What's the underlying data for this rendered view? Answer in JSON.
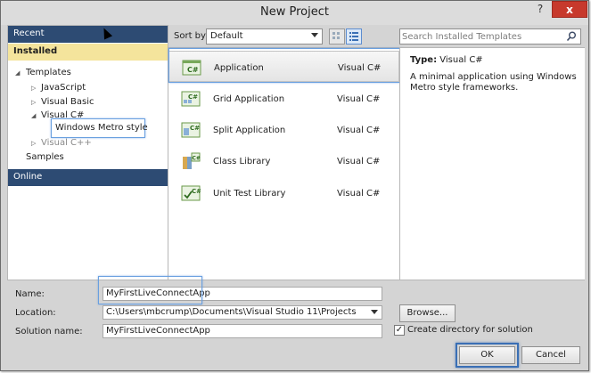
{
  "window": {
    "title": "New Project",
    "help_label": "?",
    "close_label": "x"
  },
  "left_pane": {
    "recent_label": "Recent",
    "installed_label": "Installed",
    "online_label": "Online",
    "tree": {
      "templates": "Templates",
      "javascript": "JavaScript",
      "visual_basic": "Visual Basic",
      "visual_csharp": "Visual C#",
      "windows_metro_style": "Windows Metro style",
      "visual_cpp": "Visual C++",
      "samples": "Samples"
    }
  },
  "toolbar": {
    "sort_label": "Sort by:",
    "sort_value": "Default",
    "search_placeholder": "Search Installed Templates"
  },
  "templates": [
    {
      "name": "Application",
      "lang": "Visual C#",
      "selected": true
    },
    {
      "name": "Grid Application",
      "lang": "Visual C#"
    },
    {
      "name": "Split Application",
      "lang": "Visual C#"
    },
    {
      "name": "Class Library",
      "lang": "Visual C#"
    },
    {
      "name": "Unit Test Library",
      "lang": "Visual C#"
    }
  ],
  "details": {
    "type_label": "Type:",
    "type_value": "Visual C#",
    "description": "A minimal application using Windows Metro style frameworks."
  },
  "form": {
    "name_label": "Name:",
    "name_value": "MyFirstLiveConnectApp",
    "location_label": "Location:",
    "location_value": "C:\\Users\\mbcrump\\Documents\\Visual Studio 11\\Projects",
    "solution_label": "Solution name:",
    "solution_value": "MyFirstLiveConnectApp",
    "browse_label": "Browse...",
    "create_dir_label": "Create directory for solution",
    "create_dir_checked": true,
    "check_mark": "✓",
    "ok_label": "OK",
    "cancel_label": "Cancel"
  }
}
